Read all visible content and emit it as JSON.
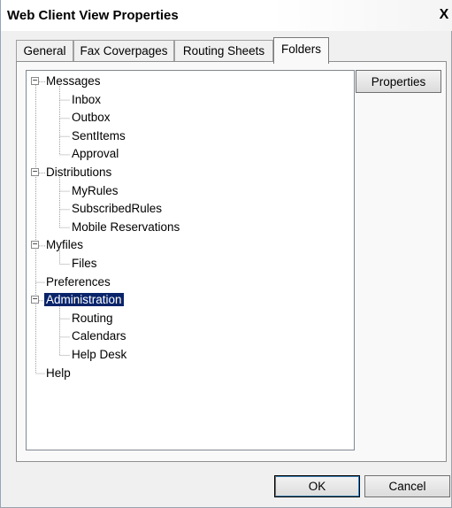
{
  "window": {
    "title": "Web Client View Properties",
    "close_glyph": "X"
  },
  "tabs": [
    {
      "label": "General",
      "active": false
    },
    {
      "label": "Fax Coverpages",
      "active": false
    },
    {
      "label": "Routing Sheets",
      "active": false
    },
    {
      "label": "Folders",
      "active": true
    }
  ],
  "tree": {
    "items": [
      {
        "label": "Messages",
        "level": 0,
        "expander": "−"
      },
      {
        "label": "Inbox",
        "level": 1
      },
      {
        "label": "Outbox",
        "level": 1
      },
      {
        "label": "SentItems",
        "level": 1
      },
      {
        "label": "Approval",
        "level": 1
      },
      {
        "label": "Distributions",
        "level": 0,
        "expander": "−"
      },
      {
        "label": "MyRules",
        "level": 1
      },
      {
        "label": "SubscribedRules",
        "level": 1
      },
      {
        "label": "Mobile Reservations",
        "level": 1
      },
      {
        "label": "Myfiles",
        "level": 0,
        "expander": "−"
      },
      {
        "label": "Files",
        "level": 1
      },
      {
        "label": "Preferences",
        "level": 0
      },
      {
        "label": "Administration",
        "level": 0,
        "expander": "−",
        "selected": true
      },
      {
        "label": "Routing",
        "level": 1
      },
      {
        "label": "Calendars",
        "level": 1
      },
      {
        "label": "Help Desk",
        "level": 1
      },
      {
        "label": "Help",
        "level": 0
      }
    ]
  },
  "buttons": {
    "properties": "Properties",
    "ok": "OK",
    "cancel": "Cancel"
  },
  "colors": {
    "selection": "#0a246a",
    "selection_text": "#ffffff"
  }
}
